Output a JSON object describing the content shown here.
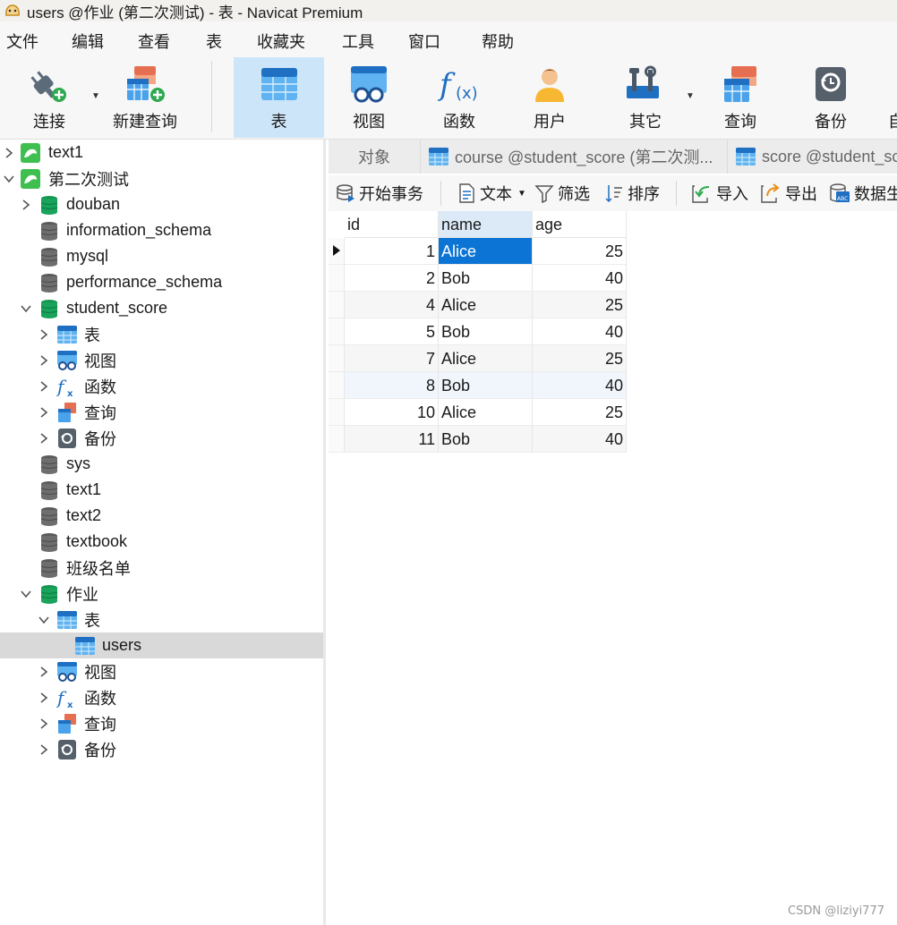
{
  "window": {
    "title": "users @作业 (第二次测试) - 表 - Navicat Premium"
  },
  "menu": [
    "文件",
    "编辑",
    "查看",
    "表",
    "收藏夹",
    "工具",
    "窗口",
    "帮助"
  ],
  "toolbar": {
    "connect": "连接",
    "new_query": "新建查询",
    "table": "表",
    "view": "视图",
    "function": "函数",
    "user": "用户",
    "other": "其它",
    "query": "查询",
    "backup": "备份",
    "auto": "自"
  },
  "tree": {
    "conn1": "text1",
    "conn2": "第二次测试",
    "db_douban": "douban",
    "db_information_schema": "information_schema",
    "db_mysql": "mysql",
    "db_performance_schema": "performance_schema",
    "db_student_score": "student_score",
    "ss_tables": "表",
    "ss_views": "视图",
    "ss_functions": "函数",
    "ss_queries": "查询",
    "ss_backups": "备份",
    "db_sys": "sys",
    "db_text1": "text1",
    "db_text2": "text2",
    "db_textbook": "textbook",
    "db_class_list": "班级名单",
    "db_homework": "作业",
    "hw_tables": "表",
    "hw_users": "users",
    "hw_views": "视图",
    "hw_functions": "函数",
    "hw_queries": "查询",
    "hw_backups": "备份"
  },
  "tabs": {
    "objects": "对象",
    "course": "course @student_score (第二次测...",
    "score": "score @student_sc"
  },
  "data_toolbar": {
    "begin_transaction": "开始事务",
    "text": "文本",
    "filter": "筛选",
    "sort": "排序",
    "import": "导入",
    "export": "导出",
    "data_generate": "数据生"
  },
  "grid": {
    "columns": [
      "id",
      "name",
      "age"
    ],
    "rows": [
      {
        "id": "1",
        "name": "Alice",
        "age": "25"
      },
      {
        "id": "2",
        "name": "Bob",
        "age": "40"
      },
      {
        "id": "4",
        "name": "Alice",
        "age": "25"
      },
      {
        "id": "5",
        "name": "Bob",
        "age": "40"
      },
      {
        "id": "7",
        "name": "Alice",
        "age": "25"
      },
      {
        "id": "8",
        "name": "Bob",
        "age": "40"
      },
      {
        "id": "10",
        "name": "Alice",
        "age": "25"
      },
      {
        "id": "11",
        "name": "Bob",
        "age": "40"
      }
    ]
  },
  "watermark": "CSDN @liziyi777",
  "colors": {
    "accent": "#0b74d4",
    "active_toolbar": "#cde5f9",
    "db_open": "#1aa35c",
    "db_closed": "#6e6e6e",
    "connection": "#3fbf4f"
  }
}
